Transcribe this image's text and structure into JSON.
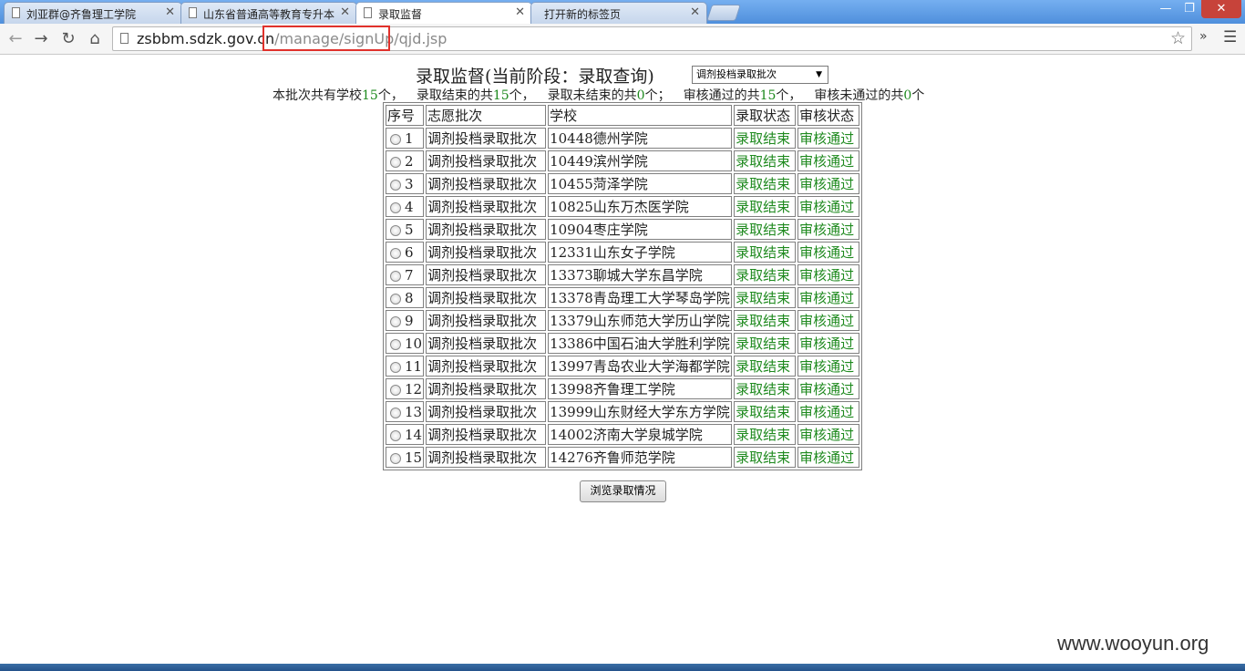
{
  "tabs": [
    {
      "title": "刘亚群@齐鲁理工学院"
    },
    {
      "title": "山东省普通高等教育专升本"
    },
    {
      "title": "录取监督"
    },
    {
      "title": "打开新的标签页"
    }
  ],
  "address": {
    "host": "zsbbm.sdzk.gov.cn",
    "path": "/manage/signUp/qjd.jsp"
  },
  "page": {
    "heading": "录取监督(当前阶段：录取查询)",
    "batch_select_value": "调剂投档录取批次",
    "summary": {
      "total_prefix": "本批次共有学校",
      "total": "15",
      "unit": "个，",
      "finished_prefix": "录取结束的共",
      "finished": "15",
      "unfinished_prefix": "录取未结束的共",
      "unfinished": "0",
      "unfinished_unit": "个；",
      "passed_prefix": "审核通过的共",
      "passed": "15",
      "notpassed_prefix": "审核未通过的共",
      "notpassed": "0",
      "last_unit": "个"
    },
    "table": {
      "headers": [
        "序号",
        "志愿批次",
        "学校",
        "录取状态",
        "审核状态"
      ],
      "rows": [
        {
          "seq": "1",
          "batch": "调剂投档录取批次",
          "school": "10448德州学院",
          "status": "录取结束",
          "audit": "审核通过"
        },
        {
          "seq": "2",
          "batch": "调剂投档录取批次",
          "school": "10449滨州学院",
          "status": "录取结束",
          "audit": "审核通过"
        },
        {
          "seq": "3",
          "batch": "调剂投档录取批次",
          "school": "10455菏泽学院",
          "status": "录取结束",
          "audit": "审核通过"
        },
        {
          "seq": "4",
          "batch": "调剂投档录取批次",
          "school": "10825山东万杰医学院",
          "status": "录取结束",
          "audit": "审核通过"
        },
        {
          "seq": "5",
          "batch": "调剂投档录取批次",
          "school": "10904枣庄学院",
          "status": "录取结束",
          "audit": "审核通过"
        },
        {
          "seq": "6",
          "batch": "调剂投档录取批次",
          "school": "12331山东女子学院",
          "status": "录取结束",
          "audit": "审核通过"
        },
        {
          "seq": "7",
          "batch": "调剂投档录取批次",
          "school": "13373聊城大学东昌学院",
          "status": "录取结束",
          "audit": "审核通过"
        },
        {
          "seq": "8",
          "batch": "调剂投档录取批次",
          "school": "13378青岛理工大学琴岛学院",
          "status": "录取结束",
          "audit": "审核通过"
        },
        {
          "seq": "9",
          "batch": "调剂投档录取批次",
          "school": "13379山东师范大学历山学院",
          "status": "录取结束",
          "audit": "审核通过"
        },
        {
          "seq": "10",
          "batch": "调剂投档录取批次",
          "school": "13386中国石油大学胜利学院",
          "status": "录取结束",
          "audit": "审核通过"
        },
        {
          "seq": "11",
          "batch": "调剂投档录取批次",
          "school": "13997青岛农业大学海都学院",
          "status": "录取结束",
          "audit": "审核通过"
        },
        {
          "seq": "12",
          "batch": "调剂投档录取批次",
          "school": "13998齐鲁理工学院",
          "status": "录取结束",
          "audit": "审核通过"
        },
        {
          "seq": "13",
          "batch": "调剂投档录取批次",
          "school": "13999山东财经大学东方学院",
          "status": "录取结束",
          "audit": "审核通过"
        },
        {
          "seq": "14",
          "batch": "调剂投档录取批次",
          "school": "14002济南大学泉城学院",
          "status": "录取结束",
          "audit": "审核通过"
        },
        {
          "seq": "15",
          "batch": "调剂投档录取批次",
          "school": "14276齐鲁师范学院",
          "status": "录取结束",
          "audit": "审核通过"
        }
      ]
    },
    "browse_button": "浏览录取情况"
  },
  "watermark": "www.wooyun.org",
  "colors": {
    "status_green": "#1f8a1f",
    "highlight_red": "#e0312b"
  }
}
